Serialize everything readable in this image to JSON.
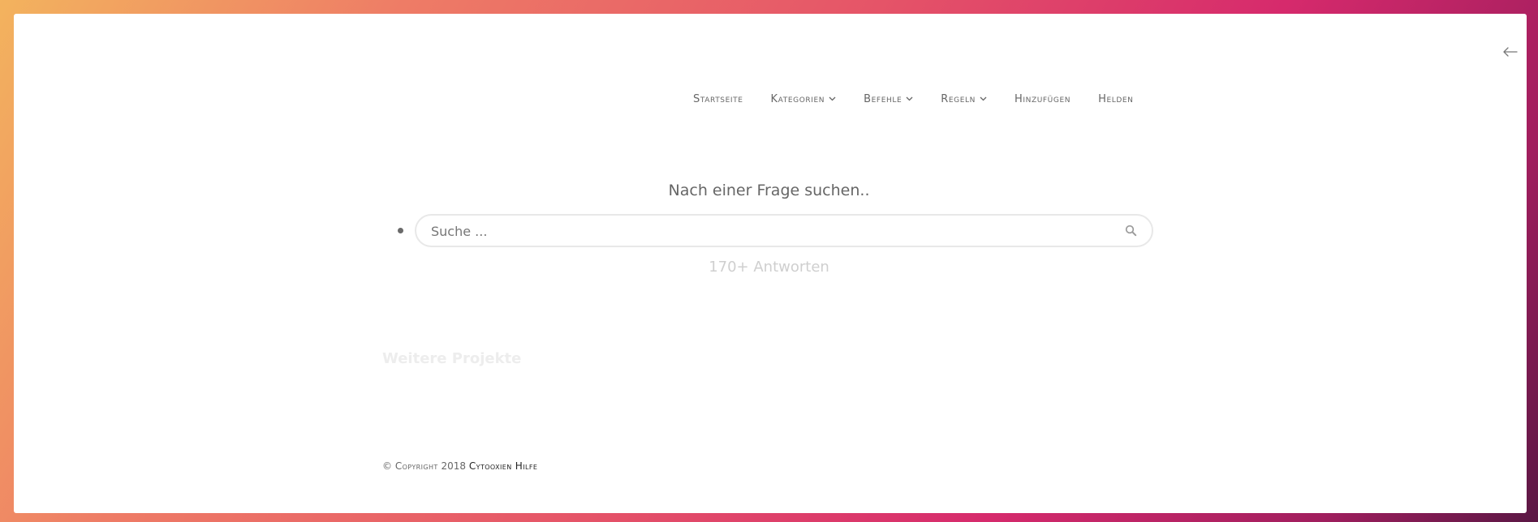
{
  "nav": {
    "items": [
      {
        "label": "Startseite",
        "has_dropdown": false
      },
      {
        "label": "Kategorien",
        "has_dropdown": true
      },
      {
        "label": "Befehle",
        "has_dropdown": true
      },
      {
        "label": "Regeln",
        "has_dropdown": true
      },
      {
        "label": "Hinzufügen",
        "has_dropdown": false
      },
      {
        "label": "Helden",
        "has_dropdown": false
      }
    ]
  },
  "search": {
    "heading": "Nach einer Frage suchen..",
    "placeholder": "Suche ...",
    "value": "",
    "answers_count": "170+ Antworten"
  },
  "projects": {
    "heading": "Weitere Projekte"
  },
  "footer": {
    "copyright_symbol": "©",
    "copyright_label": "Copyright",
    "year": "2018",
    "brand": "Cytooxien Hilfe"
  },
  "icons": {
    "back": "arrow-left-icon",
    "search": "search-icon",
    "dropdown": "chevron-down-icon"
  },
  "colors": {
    "background_gradient_start": "#f3b35e",
    "background_gradient_mid": "#e55468",
    "background_gradient_end": "#5a1744",
    "panel": "#ffffff",
    "nav_text": "#666666",
    "brand_text": "#222222"
  }
}
